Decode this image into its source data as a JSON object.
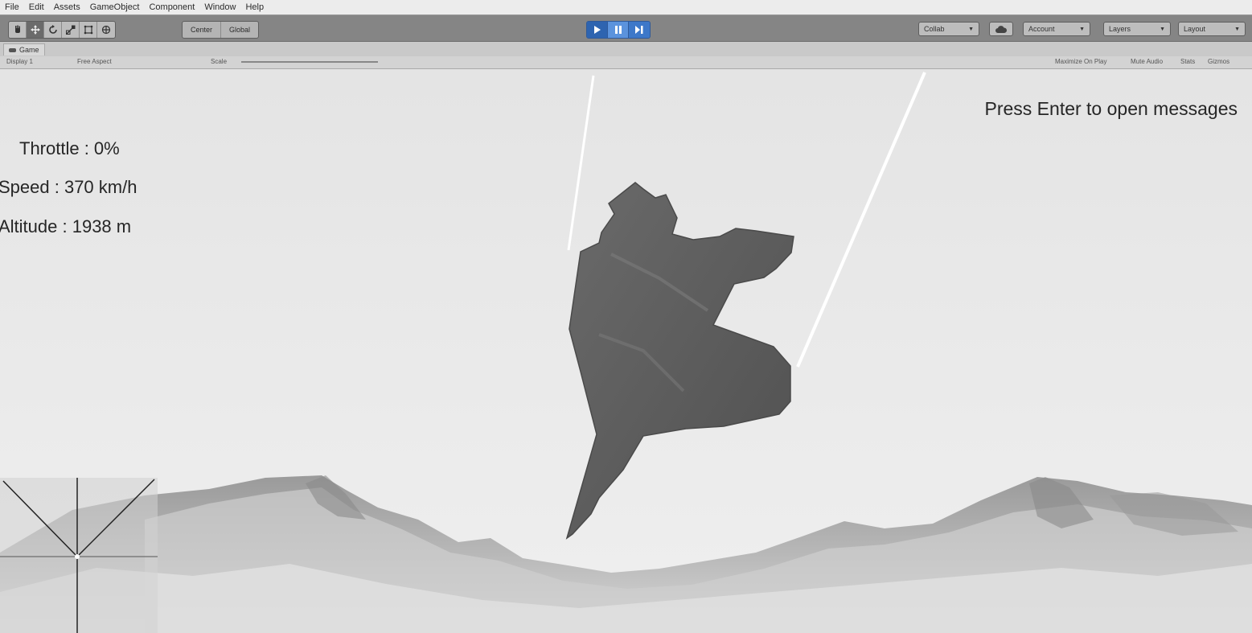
{
  "menu": [
    "File",
    "Edit",
    "Assets",
    "GameObject",
    "Component",
    "Window",
    "Help"
  ],
  "toolbar": {
    "transform_tools": [
      "hand",
      "move",
      "rotate",
      "scale",
      "rect",
      "transform"
    ],
    "pivot_label": "Center",
    "space_label": "Global",
    "play_buttons": [
      "play",
      "pause",
      "step"
    ],
    "collab_label": "Collab",
    "account_label": "Account",
    "layers_label": "Layers",
    "layout_label": "Layout"
  },
  "game_view": {
    "tab_label": "Game",
    "display_label": "Display 1",
    "aspect_label": "Free Aspect",
    "scale_label": "Scale",
    "maximize_label": "Maximize On Play",
    "mute_label": "Mute Audio",
    "stats_label": "Stats",
    "gizmos_label": "Gizmos"
  },
  "hud": {
    "throttle": "Throttle : 0%",
    "speed": "Speed : 370 km/h",
    "altitude": "Altitude : 1938 m",
    "message_prompt": "Press Enter to open messages"
  },
  "icons": {
    "hand": "hand-icon",
    "move": "move-icon",
    "rotate": "rotate-icon",
    "scale": "scale-icon",
    "rect": "rect-icon",
    "transform": "transform-icon",
    "play": "play-icon",
    "pause": "pause-icon",
    "step": "step-icon",
    "cloud": "cloud-icon"
  },
  "colors": {
    "play_accent": "#3d78c9",
    "sky": "#ececec",
    "aircraft": "#5e5e5e",
    "hud_text": "#262626"
  }
}
